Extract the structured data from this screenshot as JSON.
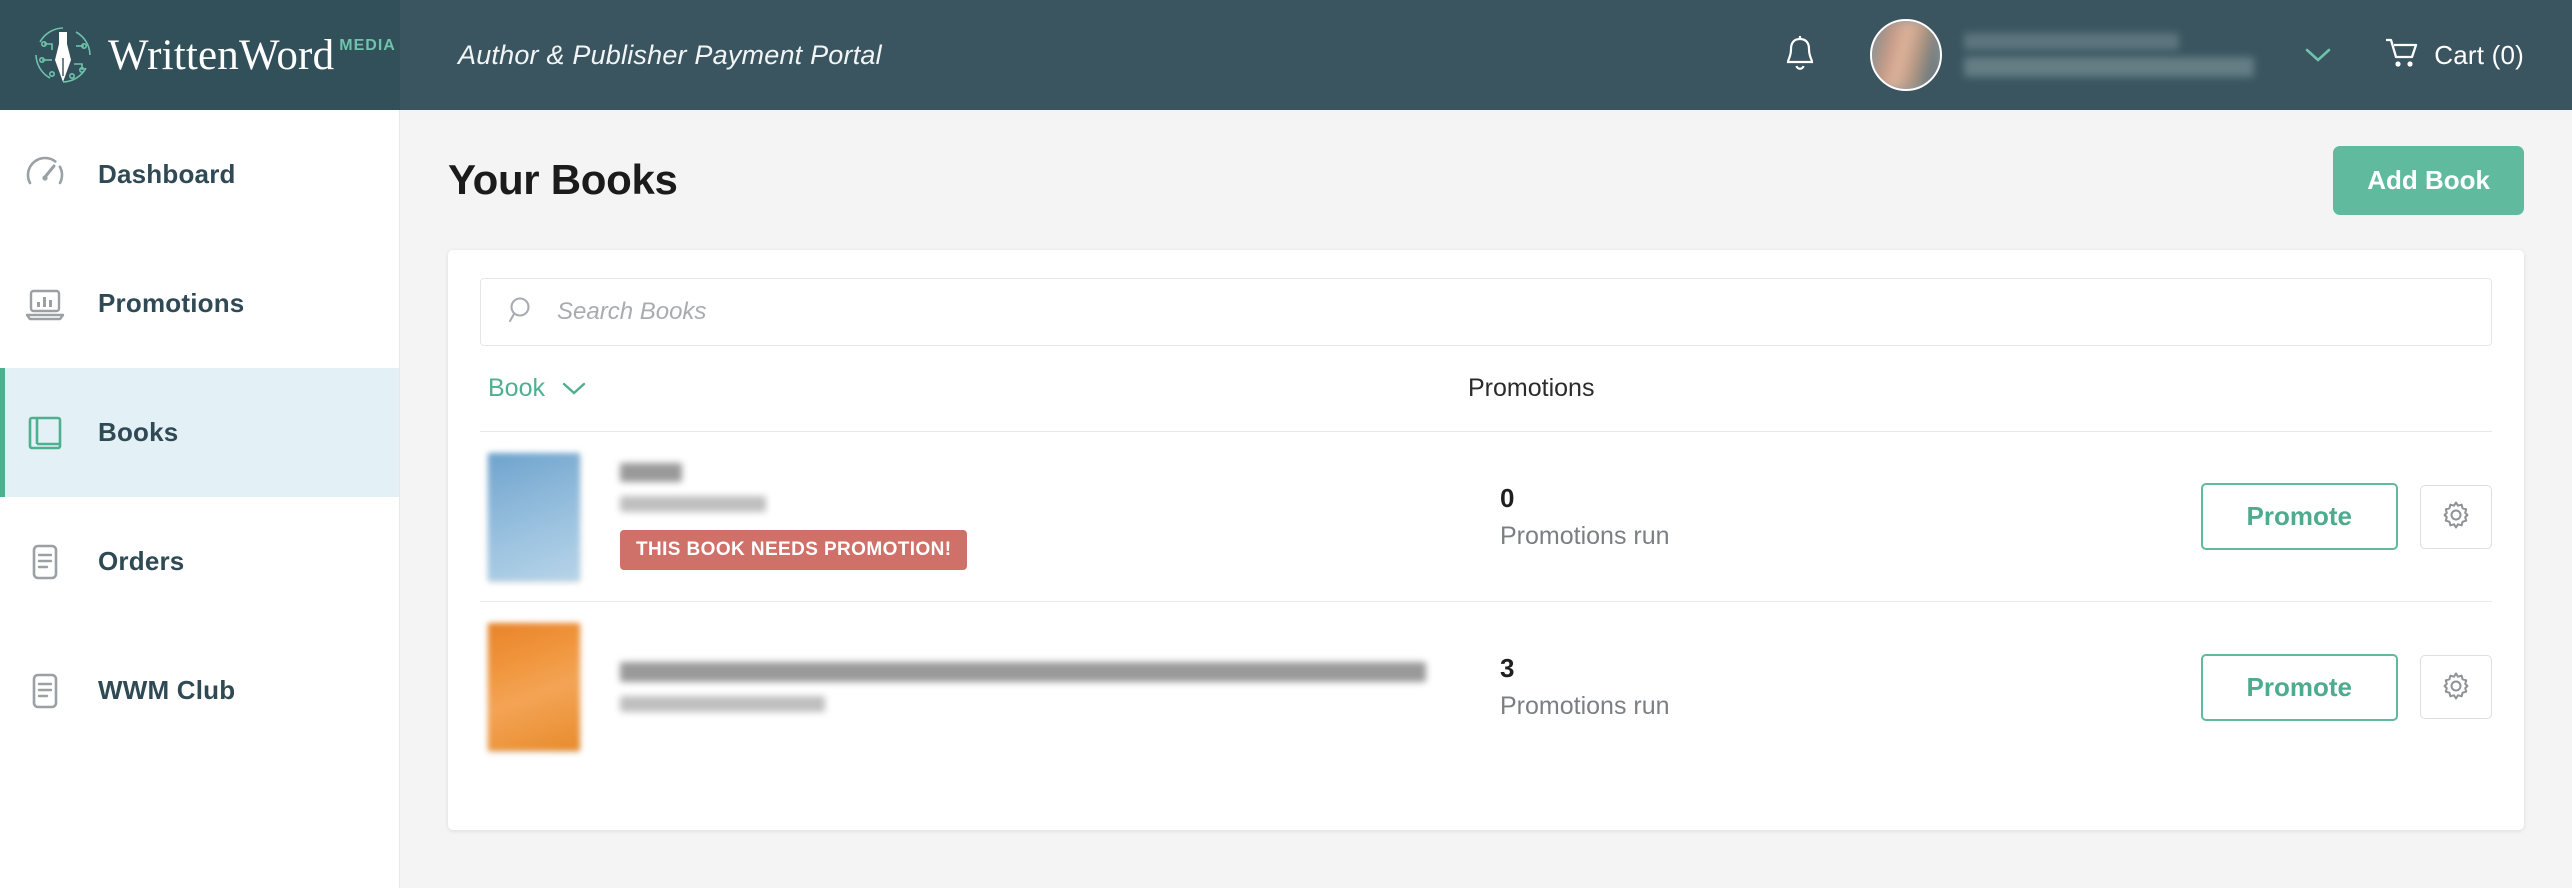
{
  "brand": {
    "word": "WrittenWord",
    "media": "MEDIA",
    "logo_icon": "pen-nib-circuit-logo"
  },
  "header": {
    "portal_title": "Author & Publisher Payment Portal",
    "bell_icon": "notification-bell-icon",
    "avatar_icon": "user-avatar",
    "user_name_redacted": "",
    "user_email_redacted": "",
    "chevron_icon": "chevron-down-icon",
    "cart_icon": "shopping-cart-icon",
    "cart_label": "Cart (0)",
    "cart_count": 0
  },
  "sidebar": {
    "items": [
      {
        "label": "Dashboard",
        "icon": "gauge-icon",
        "active": false
      },
      {
        "label": "Promotions",
        "icon": "laptop-chart-icon",
        "active": false
      },
      {
        "label": "Books",
        "icon": "book-icon",
        "active": true
      },
      {
        "label": "Orders",
        "icon": "document-icon",
        "active": false
      },
      {
        "label": "WWM Club",
        "icon": "document-icon",
        "active": false
      }
    ]
  },
  "main": {
    "page_title": "Your Books",
    "add_book_label": "Add Book",
    "search": {
      "placeholder": "Search Books",
      "value": "",
      "icon": "search-icon"
    },
    "table": {
      "columns": {
        "book": "Book",
        "promotions": "Promotions"
      },
      "sort_icon": "chevron-down-icon",
      "rows": [
        {
          "cover_color": "blue",
          "title_redacted": "",
          "author_redacted": "",
          "badge": "THIS BOOK NEEDS PROMOTION!",
          "promotions_count": "0",
          "promotions_sub": "Promotions run",
          "promote_label": "Promote",
          "settings_icon": "gear-icon"
        },
        {
          "cover_color": "orange",
          "title_redacted": "",
          "author_redacted": "",
          "badge": null,
          "promotions_count": "3",
          "promotions_sub": "Promotions run",
          "promote_label": "Promote",
          "settings_icon": "gear-icon"
        }
      ]
    }
  },
  "colors": {
    "header_bg": "#3a5560",
    "logo_bg": "#32505a",
    "accent_green": "#5fba9e",
    "accent_teal_text": "#4fb08f",
    "active_nav_bg": "#e3f0f6",
    "badge_red": "#cf7069",
    "page_bg": "#f4f4f5"
  }
}
